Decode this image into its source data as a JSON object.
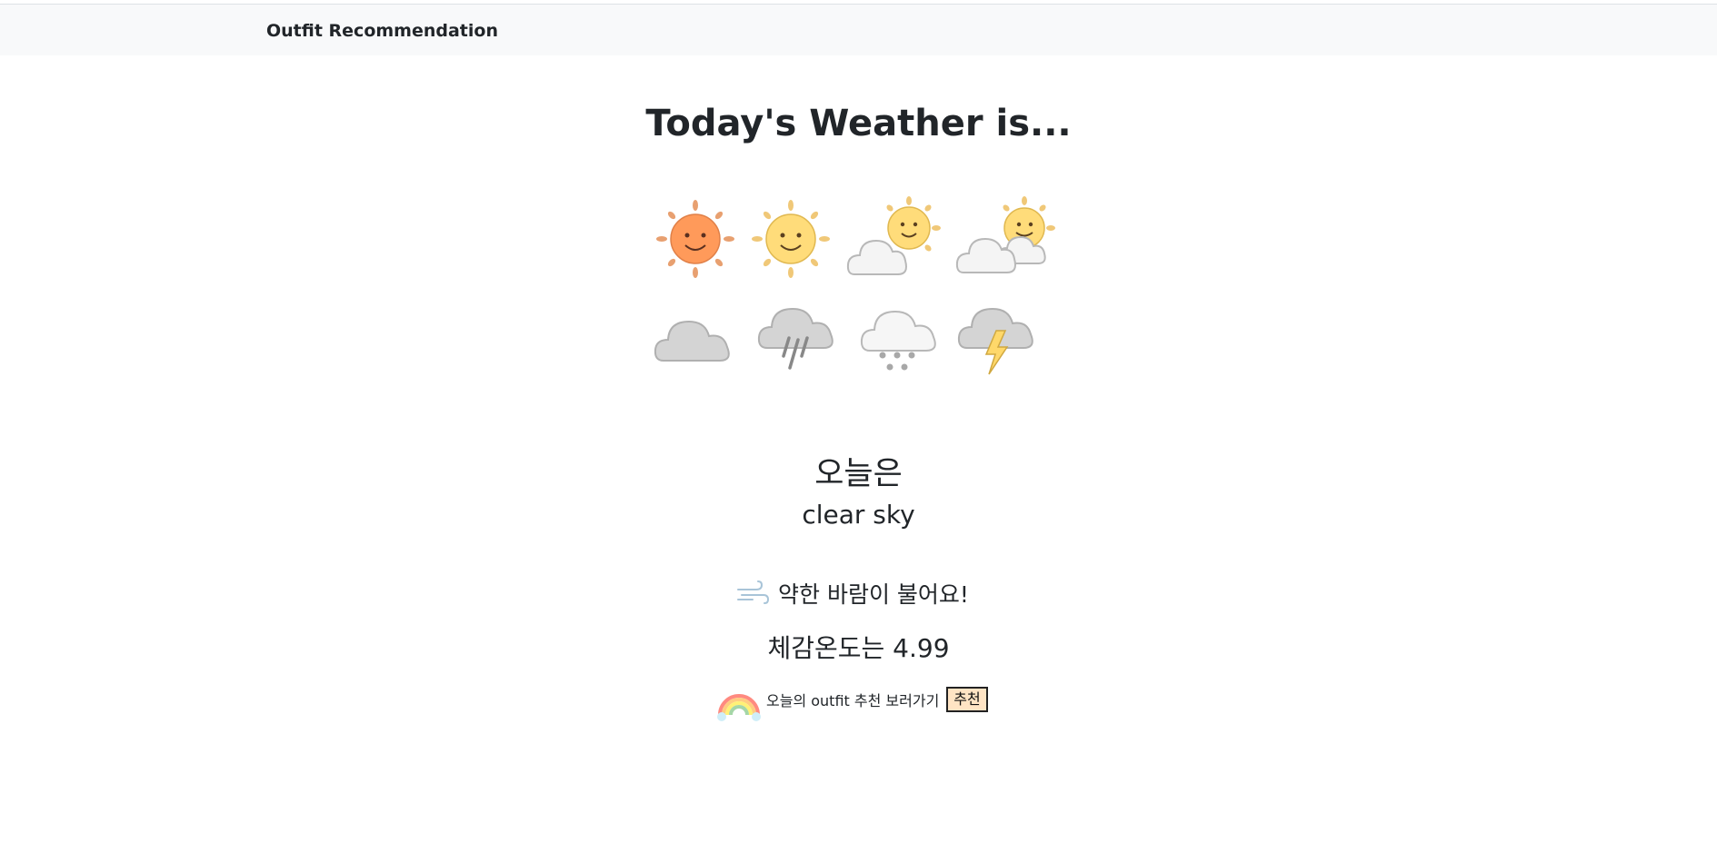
{
  "navbar": {
    "brand": "Outfit Recommendation"
  },
  "main": {
    "title": "Today's Weather is...",
    "weather_icons": [
      "sun-hot-icon",
      "sun-icon",
      "sun-behind-cloud-icon",
      "sun-behind-clouds-icon",
      "cloud-icon",
      "rain-cloud-icon",
      "snow-cloud-icon",
      "thunder-cloud-icon"
    ],
    "today_label": "오늘은",
    "description": "clear sky",
    "wind": {
      "icon": "wind-icon",
      "text": "약한 바람이 불어요!"
    },
    "feels_like": "체감온도는 4.99",
    "recommendation": {
      "icon": "rainbow-icon",
      "text": "오늘의 outfit 추천 보러가기",
      "button": "추천"
    }
  },
  "colors": {
    "navbar_bg": "#f8f9fa",
    "hot_sun": "#ff9a5a",
    "sun": "#ffdc7a",
    "cloud": "#d4d4d4",
    "button_bg": "#ffe4c4"
  }
}
